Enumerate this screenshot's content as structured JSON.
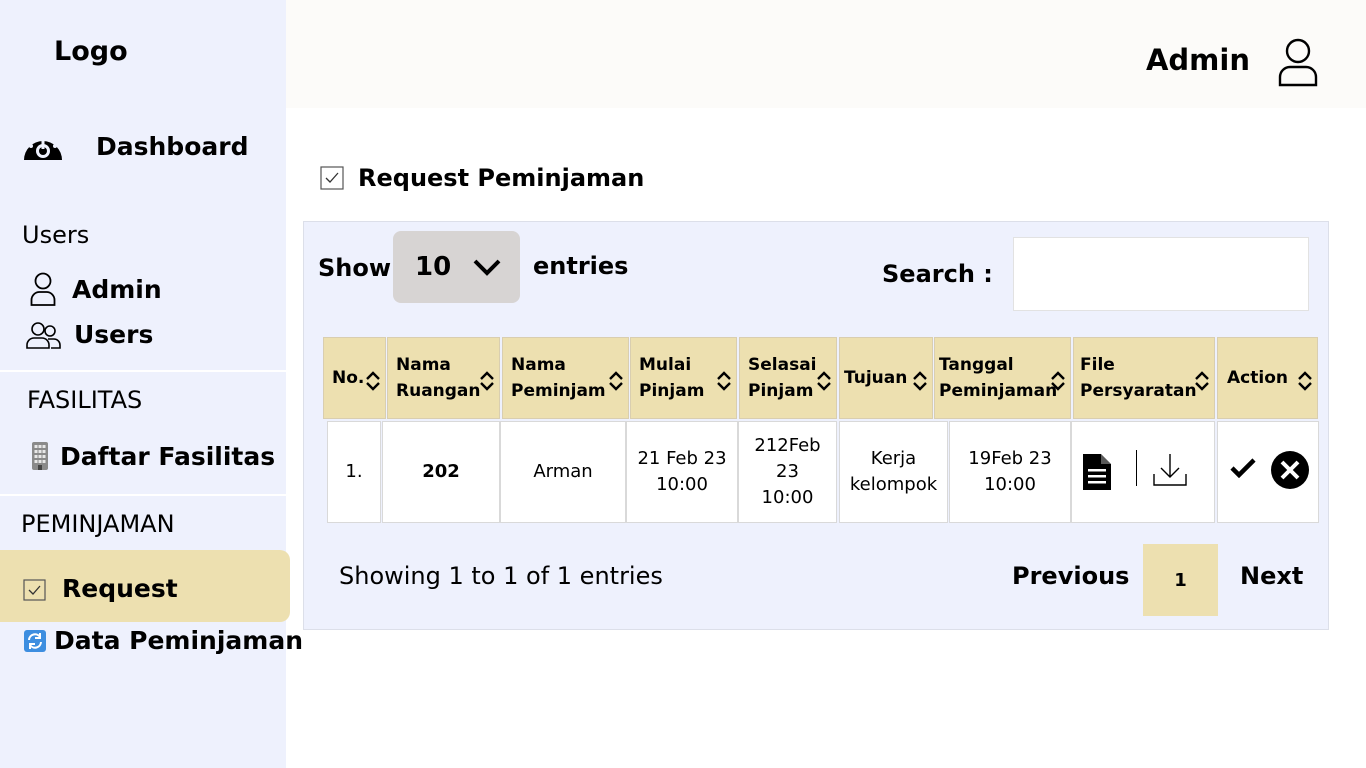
{
  "sidebar": {
    "logo": "Logo",
    "dashboard": "Dashboard",
    "users_section": "Users",
    "admin": "Admin",
    "users": "Users",
    "fasilitas_section": "FASILITAS",
    "daftar_fasilitas": "Daftar Fasilitas",
    "peminjaman_section": "PEMINJAMAN",
    "request": "Request",
    "data_peminjaman": "Data Peminjaman"
  },
  "topbar": {
    "user": "Admin"
  },
  "page": {
    "title": "Request Peminjaman"
  },
  "table_controls": {
    "show_label": "Show",
    "entries_value": "10",
    "entries_label": "entries",
    "search_label": "Search :",
    "search_value": ""
  },
  "table": {
    "headers": [
      "No.",
      "Nama\nRuangan",
      "Nama\nPeminjam",
      "Mulai\nPinjam",
      "Selasai\nPinjam",
      "Tujuan",
      "Tanggal\nPeminjaman",
      "File\nPersyaratan",
      "Action"
    ],
    "rows": [
      {
        "no": "1.",
        "ruangan": "202",
        "peminjam": "Arman",
        "mulai": "21 Feb 23\n10:00",
        "selesai": "212Feb\n23\n10:00",
        "tujuan": "Kerja\nkelompok",
        "tanggal": "19Feb 23\n10:00"
      }
    ]
  },
  "pagination": {
    "info": "Showing 1 to 1 of 1 entries",
    "previous": "Previous",
    "page": "1",
    "next": "Next"
  },
  "colors": {
    "sidebar_bg": "#eef1fd",
    "accent": "#ede0b0",
    "panel_bg": "#eef1fd"
  }
}
